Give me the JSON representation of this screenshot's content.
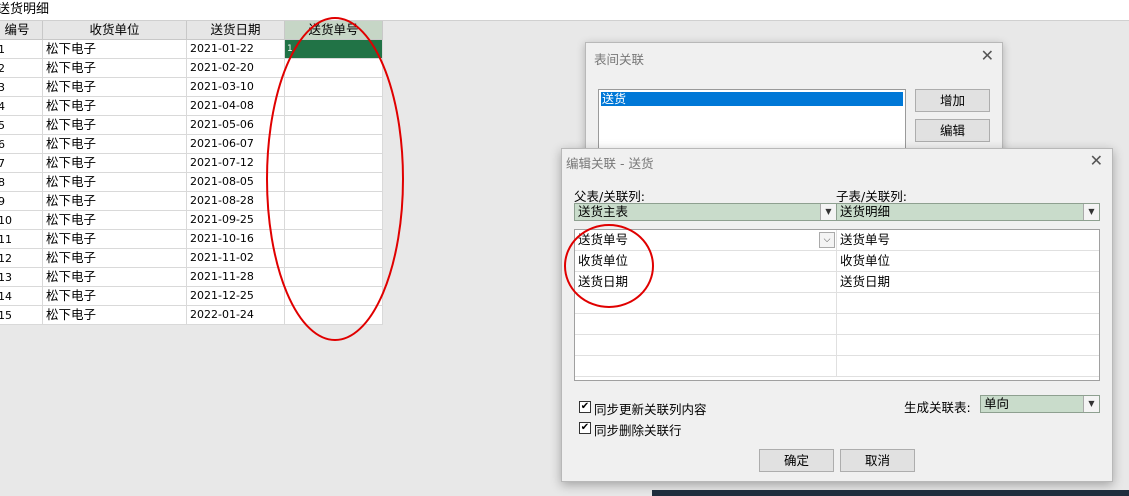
{
  "sheet": {
    "title": "送货明细"
  },
  "grid": {
    "headers": [
      "编号",
      "收货单位",
      "送货日期",
      "送货单号"
    ],
    "active_cell_text": "1",
    "rows": [
      {
        "idx": "1",
        "unit": "松下电子",
        "date": "2021-01-22"
      },
      {
        "idx": "2",
        "unit": "松下电子",
        "date": "2021-02-20"
      },
      {
        "idx": "3",
        "unit": "松下电子",
        "date": "2021-03-10"
      },
      {
        "idx": "4",
        "unit": "松下电子",
        "date": "2021-04-08"
      },
      {
        "idx": "5",
        "unit": "松下电子",
        "date": "2021-05-06"
      },
      {
        "idx": "6",
        "unit": "松下电子",
        "date": "2021-06-07"
      },
      {
        "idx": "7",
        "unit": "松下电子",
        "date": "2021-07-12"
      },
      {
        "idx": "8",
        "unit": "松下电子",
        "date": "2021-08-05"
      },
      {
        "idx": "9",
        "unit": "松下电子",
        "date": "2021-08-28"
      },
      {
        "idx": "10",
        "unit": "松下电子",
        "date": "2021-09-25"
      },
      {
        "idx": "11",
        "unit": "松下电子",
        "date": "2021-10-16"
      },
      {
        "idx": "12",
        "unit": "松下电子",
        "date": "2021-11-02"
      },
      {
        "idx": "13",
        "unit": "松下电子",
        "date": "2021-11-28"
      },
      {
        "idx": "14",
        "unit": "松下电子",
        "date": "2021-12-25"
      },
      {
        "idx": "15",
        "unit": "松下电子",
        "date": "2022-01-24"
      }
    ]
  },
  "back_dialog": {
    "title": "表间关联",
    "close_glyph": "✕",
    "list_items": [
      "送货"
    ],
    "add_label": "增加",
    "edit_label": "编辑"
  },
  "front_dialog": {
    "title": "编辑关联 - 送货",
    "close_glyph": "✕",
    "parent_label": "父表/关联列:",
    "child_label": "子表/关联列:",
    "parent_table": "送货主表",
    "child_table": "送货明细",
    "mappings": [
      {
        "parent": "送货单号",
        "child": "送货单号"
      },
      {
        "parent": "收货单位",
        "child": "收货单位"
      },
      {
        "parent": "送货日期",
        "child": "送货日期"
      },
      {
        "parent": "",
        "child": ""
      },
      {
        "parent": "",
        "child": ""
      },
      {
        "parent": "",
        "child": ""
      },
      {
        "parent": "",
        "child": ""
      }
    ],
    "sync_update_label": "同步更新关联列内容",
    "sync_update_checked": true,
    "sync_delete_label": "同步删除关联行",
    "sync_delete_checked": true,
    "gen_table_label": "生成关联表:",
    "gen_table_value": "单向",
    "ok_label": "确定",
    "cancel_label": "取消"
  },
  "colors": {
    "active_cell": "#217346",
    "selected_header": "#c6d6c6",
    "combo_fill": "#c9dccb",
    "list_selection": "#0078d7",
    "annotation": "#e00000"
  },
  "icons": {
    "checkbox_check": "check-icon",
    "dropdown": "chevron-down-icon",
    "close": "close-icon"
  }
}
